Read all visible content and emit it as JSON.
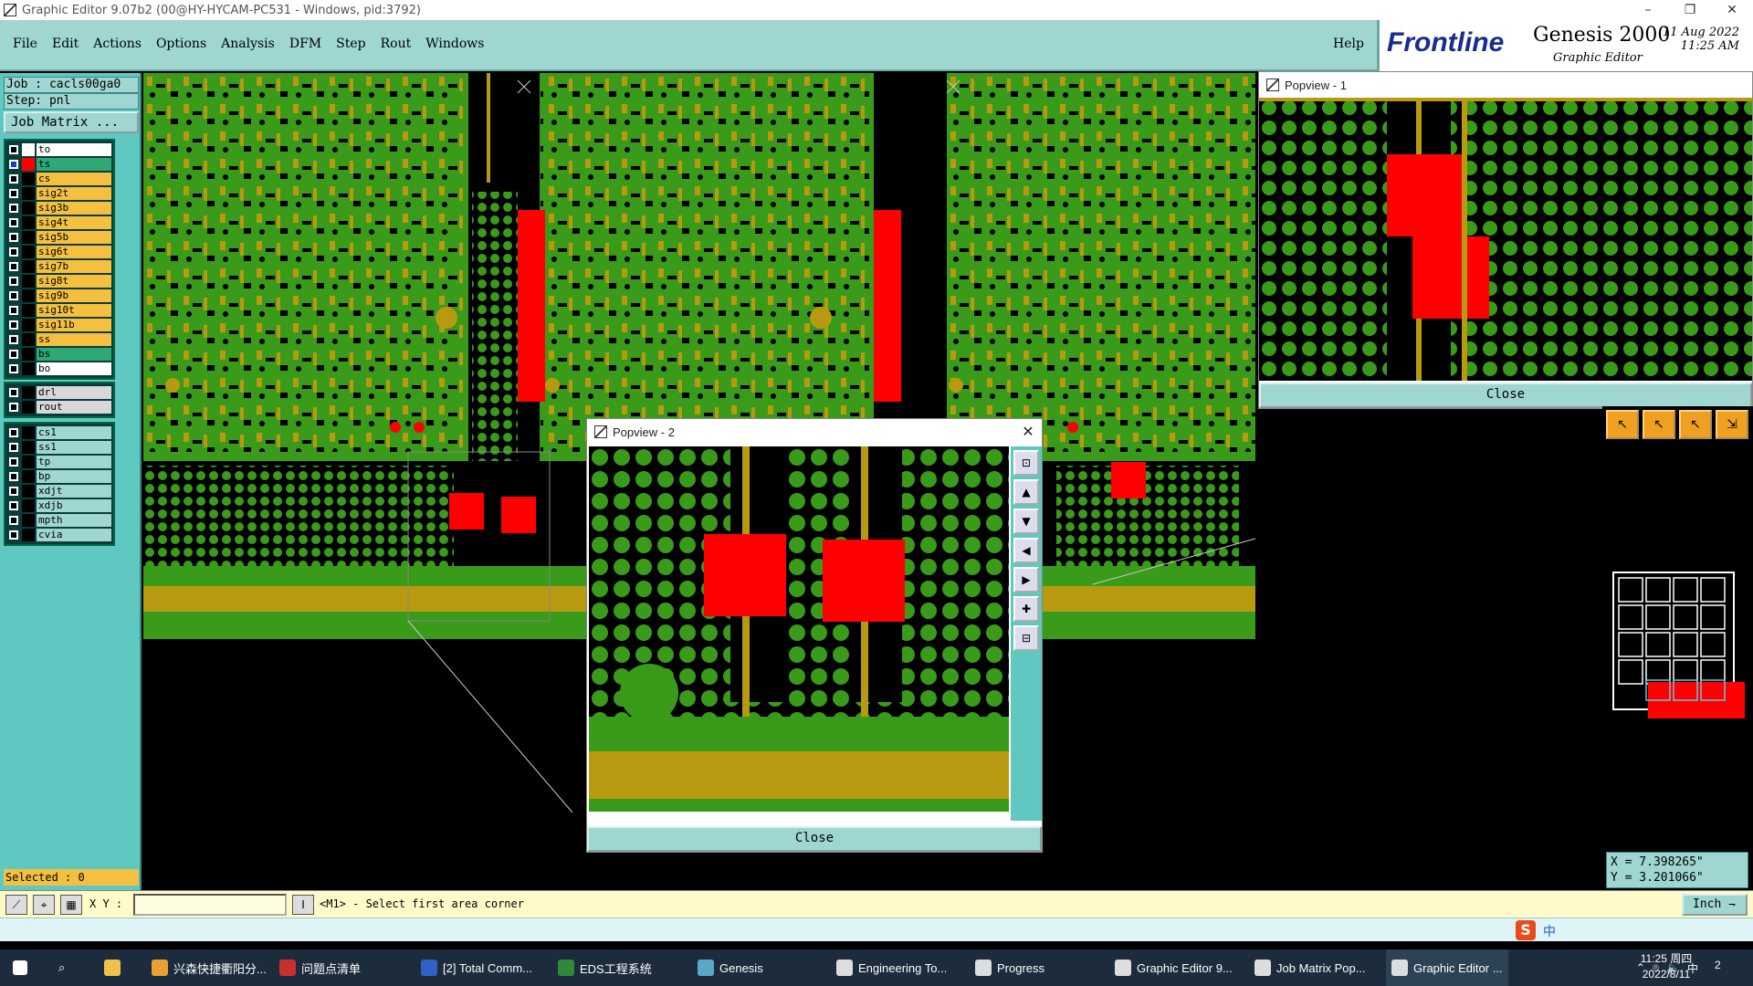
{
  "window": {
    "title": "Graphic Editor 9.07b2 (00@HY-HYCAM-PC531 - Windows, pid:3792)"
  },
  "menu": {
    "items": [
      "File",
      "Edit",
      "Actions",
      "Options",
      "Analysis",
      "DFM",
      "Step",
      "Rout",
      "Windows"
    ],
    "help": "Help"
  },
  "logo": {
    "brand": "Frontline",
    "product": "Genesis 2000",
    "subtitle": "Graphic Editor",
    "date": "11 Aug 2022",
    "time": "11:25 AM"
  },
  "left": {
    "job": "Job : cacls00ga0",
    "step": "Step: pnl",
    "job_matrix": "Job Matrix ...",
    "layers_main": [
      {
        "name": "to",
        "color": "#ffffff",
        "bg": "#ffffff",
        "checked": false
      },
      {
        "name": "ts",
        "color": "#ff0000",
        "bg": "#2fa878",
        "checked": true
      },
      {
        "name": "cs",
        "color": "#000000",
        "bg": "#f5c040",
        "checked": false
      },
      {
        "name": "sig2t",
        "color": "#000000",
        "bg": "#f5c040",
        "checked": false
      },
      {
        "name": "sig3b",
        "color": "#000000",
        "bg": "#f5c040",
        "checked": false
      },
      {
        "name": "sig4t",
        "color": "#000000",
        "bg": "#f5c040",
        "checked": false
      },
      {
        "name": "sig5b",
        "color": "#000000",
        "bg": "#f5c040",
        "checked": false
      },
      {
        "name": "sig6t",
        "color": "#000000",
        "bg": "#f5c040",
        "checked": false
      },
      {
        "name": "sig7b",
        "color": "#000000",
        "bg": "#f5c040",
        "checked": false
      },
      {
        "name": "sig8t",
        "color": "#000000",
        "bg": "#f5c040",
        "checked": false
      },
      {
        "name": "sig9b",
        "color": "#000000",
        "bg": "#f5c040",
        "checked": false
      },
      {
        "name": "sig10t",
        "color": "#000000",
        "bg": "#f5c040",
        "checked": false
      },
      {
        "name": "sig11b",
        "color": "#000000",
        "bg": "#f5c040",
        "checked": false
      },
      {
        "name": "ss",
        "color": "#000000",
        "bg": "#f5c040",
        "checked": false
      },
      {
        "name": "bs",
        "color": "#000000",
        "bg": "#2fa878",
        "checked": false
      },
      {
        "name": "bo",
        "color": "#000000",
        "bg": "#ffffff",
        "checked": false
      }
    ],
    "layers_drill": [
      {
        "name": "drl",
        "color": "#000000",
        "bg": "#d8d8d8",
        "checked": false
      },
      {
        "name": "rout",
        "color": "#000000",
        "bg": "#d8d8d8",
        "checked": false
      }
    ],
    "layers_misc": [
      {
        "name": "cs1",
        "color": "#000000",
        "bg": "#9fd6d2",
        "checked": false
      },
      {
        "name": "ss1",
        "color": "#000000",
        "bg": "#9fd6d2",
        "checked": false
      },
      {
        "name": "tp",
        "color": "#000000",
        "bg": "#9fd6d2",
        "checked": false
      },
      {
        "name": "bp",
        "color": "#000000",
        "bg": "#9fd6d2",
        "checked": false
      },
      {
        "name": "xdjt",
        "color": "#000000",
        "bg": "#9fd6d2",
        "checked": false
      },
      {
        "name": "xdjb",
        "color": "#000000",
        "bg": "#9fd6d2",
        "checked": false
      },
      {
        "name": "mpth",
        "color": "#000000",
        "bg": "#9fd6d2",
        "checked": false
      },
      {
        "name": "cvia",
        "color": "#000000",
        "bg": "#9fd6d2",
        "checked": false
      }
    ],
    "selected": "Selected : 0"
  },
  "popview1": {
    "title": "Popview - 1",
    "close": "Close"
  },
  "popview2": {
    "title": "Popview - 2",
    "close": "Close"
  },
  "coords": {
    "x": "X = 7.398265\"",
    "y": "Y = 3.201066\""
  },
  "status": {
    "xy_label": "X Y :",
    "xy_value": "",
    "message": "<M1> - Select first area corner",
    "unit": "Inch"
  },
  "taskbar": {
    "items": [
      "兴森快捷衢阳分...",
      "问题点清单",
      "[2] Total Comm...",
      "EDS工程系统",
      "Genesis",
      "Engineering To...",
      "Progress",
      "Graphic Editor 9...",
      "Job Matrix Pop...",
      "Graphic Editor ..."
    ],
    "time": "11:25 周四",
    "date": "2022/8/11",
    "ime": "中",
    "notif": "2"
  },
  "colors": {
    "board_green": "#3a9a1a",
    "copper_yellow": "#b89a10",
    "pad_red": "#ff0000",
    "panel_teal": "#5fc8c0",
    "menu_teal": "#9fd6d2"
  }
}
